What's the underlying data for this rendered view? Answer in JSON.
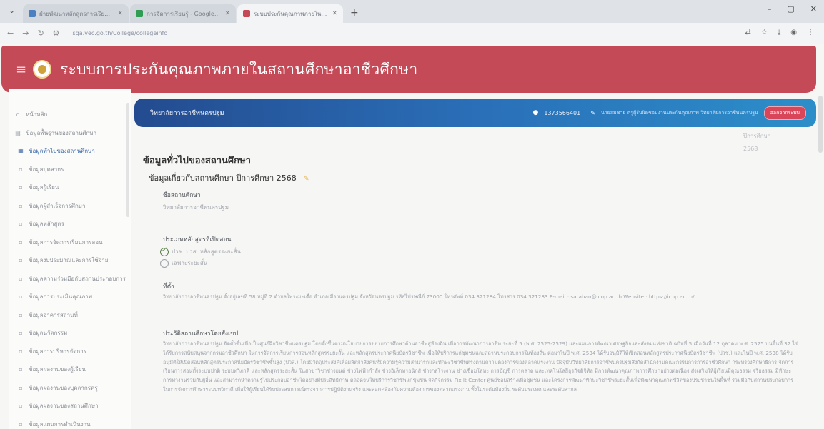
{
  "browser": {
    "tabs": [
      {
        "label": "ฝ่ายพัฒนาหลักสูตรการเรียนการสอน",
        "favicon_color": "#4a7fc1",
        "active": false
      },
      {
        "label": "การจัดการเรียนรู้ - Google ชีต",
        "favicon_color": "#2f9e54",
        "active": false
      },
      {
        "label": "ระบบประกันคุณภาพภายในสถานศึกษา",
        "favicon_color": "#c44a57",
        "active": true
      }
    ],
    "newtab": "+",
    "url": "sqa.vec.go.th/College/collegeinfo",
    "win": {
      "min": "–",
      "max": "▢",
      "close": "✕"
    }
  },
  "app": {
    "title": "ระบบการประกันคุณภาพภายในสถานศึกษาอาชีวศึกษา",
    "header_color": "#c44a57"
  },
  "sidebar": {
    "items": [
      {
        "icon": "⌂",
        "label": "หน้าหลัก",
        "sub": false,
        "active": false
      },
      {
        "icon": "▤",
        "label": "ข้อมูลพื้นฐานของสถานศึกษา",
        "sub": false,
        "active": false
      },
      {
        "icon": "▦",
        "label": "ข้อมูลทั่วไปของสถานศึกษา",
        "sub": true,
        "active": true
      },
      {
        "icon": "▫",
        "label": "ข้อมูลบุคลากร",
        "sub": true,
        "active": false
      },
      {
        "icon": "▫",
        "label": "ข้อมูลผู้เรียน",
        "sub": true,
        "active": false
      },
      {
        "icon": "▫",
        "label": "ข้อมูลผู้สำเร็จการศึกษา",
        "sub": true,
        "active": false
      },
      {
        "icon": "▫",
        "label": "ข้อมูลหลักสูตร",
        "sub": true,
        "active": false
      },
      {
        "icon": "▫",
        "label": "ข้อมูลการจัดการเรียนการสอน",
        "sub": true,
        "active": false
      },
      {
        "icon": "▫",
        "label": "ข้อมูลงบประมาณและการใช้จ่าย",
        "sub": true,
        "active": false
      },
      {
        "icon": "▫",
        "label": "ข้อมูลความร่วมมือกับสถานประกอบการ",
        "sub": true,
        "active": false
      },
      {
        "icon": "▫",
        "label": "ข้อมูลการประเมินคุณภาพ",
        "sub": true,
        "active": false
      },
      {
        "icon": "▫",
        "label": "ข้อมูลอาคารสถานที่",
        "sub": true,
        "active": false
      },
      {
        "icon": "▫",
        "label": "ข้อมูลนวัตกรรม",
        "sub": true,
        "active": false
      },
      {
        "icon": "▫",
        "label": "ข้อมูลการบริหารจัดการ",
        "sub": true,
        "active": false
      },
      {
        "icon": "▫",
        "label": "ข้อมูลผลงานของผู้เรียน",
        "sub": true,
        "active": false
      },
      {
        "icon": "▫",
        "label": "ข้อมูลผลงานของบุคลากรครู",
        "sub": true,
        "active": false
      },
      {
        "icon": "▫",
        "label": "ข้อมูลผลงานของสถานศึกษา",
        "sub": true,
        "active": false
      },
      {
        "icon": "▫",
        "label": "ข้อมูลแผนการดำเนินงาน",
        "sub": true,
        "active": false
      }
    ]
  },
  "subheader": {
    "college": "วิทยาลัยการอาชีพนครปฐม",
    "user_icon": "●",
    "user_id": "1373566401",
    "pen_icon": "✎",
    "user_desc": "นายสมชาย ครูผู้รับผิดชอบงานประกันคุณภาพ วิทยาลัยการอาชีพนครปฐม",
    "logout": "ออกจากระบบ"
  },
  "year_select": {
    "label": "ปีการศึกษา",
    "value": "2568"
  },
  "page": {
    "heading": "ข้อมูลทั่วไปของสถานศึกษา",
    "subheading": "ข้อมูลเกี่ยวกับสถานศึกษา ปีการศึกษา 2568",
    "edit_icon": "✎",
    "name_label": "ชื่อสถานศึกษา",
    "name_value": "วิทยาลัยการอาชีพนครปฐม",
    "course_label": "ประเภทหลักสูตรที่เปิดสอน",
    "course_options": [
      {
        "label": "ปวช. ปวส. หลักสูตรระยะสั้น",
        "checked": true
      },
      {
        "label": "เฉพาะระยะสั้น",
        "checked": false
      }
    ],
    "address_label": "ที่ตั้ง",
    "address_value": "วิทยาลัยการอาชีพนครปฐม ตั้งอยู่เลขที่ 58 หมู่ที่ 2 ตำบลโพรงมะเดื่อ อำเภอเมืองนครปฐม จังหวัดนครปฐม รหัสไปรษณีย์ 73000 โทรศัพท์ 034 321284 โทรสาร 034 321283 E-mail : saraban@icnp.ac.th Website : https://icnp.ac.th/",
    "history_label": "ประวัติสถานศึกษาโดยสังเขป",
    "history_value": "วิทยาลัยการอาชีพนครปฐม จัดตั้งขึ้นเพื่อเป็นศูนย์ฝึกวิชาชีพนครปฐม โดยตั้งขึ้นตามนโยบายการขยายการศึกษาด้านอาชีพสู่ท้องถิ่น เพื่อการพัฒนาการอาชีพ ระยะที่ 5 (พ.ศ. 2525-2529) และแผนการพัฒนาเศรษฐกิจและสังคมแห่งชาติ ฉบับที่ 5 เมื่อวันที่ 12 ตุลาคม พ.ศ. 2525 บนพื้นที่ 32 ไร่ ได้รับการสนับสนุนจากกรมอาชีวศึกษา ในการจัดการเรียนการสอนหลักสูตรระยะสั้น และหลักสูตรประกาศนียบัตรวิชาชีพ เพื่อให้บริการแก่ชุมชนและสถานประกอบการในท้องถิ่น ต่อมาในปี พ.ศ. 2534 ได้รับอนุมัติให้เปิดสอนหลักสูตรประกาศนียบัตรวิชาชีพ (ปวช.) และในปี พ.ศ. 2538 ได้รับอนุมัติให้เปิดสอนหลักสูตรประกาศนียบัตรวิชาชีพชั้นสูง (ปวส.) โดยมีวัตถุประสงค์เพื่อผลิตกำลังคนที่มีความรู้ความสามารถและทักษะวิชาชีพตรงตามความต้องการของตลาดแรงงาน ปัจจุบันวิทยาลัยการอาชีพนครปฐมสังกัดสำนักงานคณะกรรมการการอาชีวศึกษา กระทรวงศึกษาธิการ จัดการเรียนการสอนทั้งระบบปกติ ระบบทวิภาคี และหลักสูตรระยะสั้น ในสาขาวิชาช่างยนต์ ช่างไฟฟ้ากำลัง ช่างอิเล็กทรอนิกส์ ช่างกลโรงงาน ช่างเชื่อมโลหะ การบัญชี การตลาด และเทคโนโลยีธุรกิจดิจิทัล มีการพัฒนาคุณภาพการศึกษาอย่างต่อเนื่อง ส่งเสริมให้ผู้เรียนมีคุณธรรม จริยธรรม มีทักษะการทำงานร่วมกับผู้อื่น และสามารถนำความรู้ไปประกอบอาชีพได้อย่างมีประสิทธิภาพ ตลอดจนให้บริการวิชาชีพแก่ชุมชน จัดกิจกรรม Fix It Center ศูนย์ซ่อมสร้างเพื่อชุมชน และโครงการพัฒนาทักษะวิชาชีพระยะสั้นเพื่อพัฒนาคุณภาพชีวิตของประชาชนในพื้นที่ ร่วมมือกับสถานประกอบการในการจัดการศึกษาระบบทวิภาคี เพื่อให้ผู้เรียนได้รับประสบการณ์ตรงจากการปฏิบัติงานจริง และสอดคล้องกับความต้องการของตลาดแรงงาน ทั้งในระดับท้องถิ่น ระดับประเทศ และระดับสากล"
  }
}
